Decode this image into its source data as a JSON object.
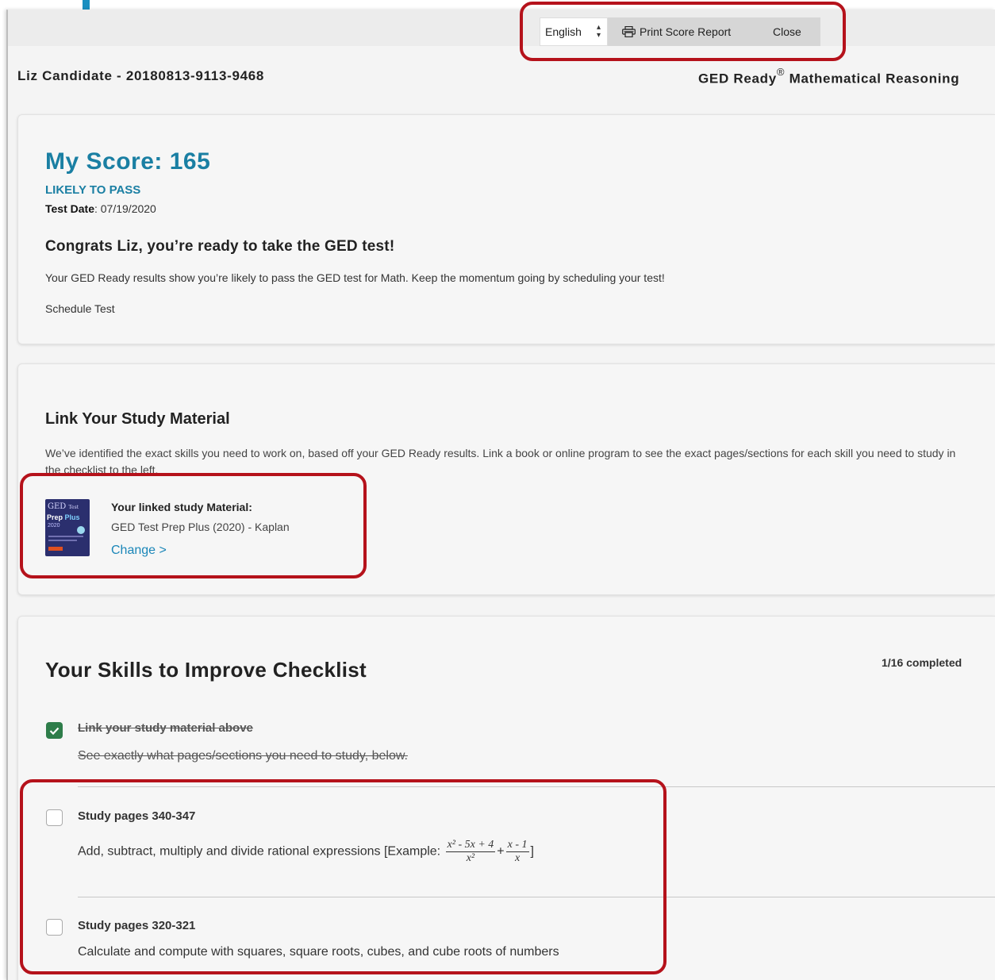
{
  "toolbar": {
    "language": "English",
    "print_label": "Print Score Report",
    "close_label": "Close"
  },
  "header": {
    "candidate": "Liz Candidate - 20180813-9113-9468",
    "test_name_pre": "GED Ready",
    "test_name_mark": "®",
    "test_name_post": " Mathematical Reasoning"
  },
  "score": {
    "title": "My Score: 165",
    "status": "LIKELY TO PASS",
    "test_date_label": "Test Date",
    "test_date_value": ": 07/19/2020",
    "congrats": "Congrats Liz, you’re ready to take the GED test!",
    "message": "Your GED Ready results show you’re likely to pass the GED test for Math. Keep the momentum going by scheduling your test!",
    "schedule_label": "Schedule Test"
  },
  "study_material": {
    "heading": "Link Your Study Material",
    "description": "We’ve identified the exact skills you need to work on, based off your GED Ready results. Link a book or online program to see the exact pages/sections for each skill you need to study in the checklist to the left.",
    "linked_label": "Your linked study Material:",
    "linked_name": "GED Test Prep Plus (2020) - Kaplan",
    "change_label": "Change >",
    "book_cover": {
      "line1": "GED",
      "line1_small": "Test",
      "line2a": "Prep",
      "line2b": " Plus",
      "line3": "2020"
    }
  },
  "checklist": {
    "heading": "Your Skills to Improve Checklist",
    "progress": "1/16 completed",
    "items": [
      {
        "title": "Link your study material above",
        "description": "See exactly what pages/sections you need to study, below.",
        "checked": true
      },
      {
        "title": "Study pages 340-347",
        "description": "Add, subtract, multiply and divide rational expressions [Example: ",
        "description_end": "]",
        "fraction1_num": "x² - 5x + 4",
        "fraction1_den": "x²",
        "operator": "+",
        "fraction2_num": "x - 1",
        "fraction2_den": "x",
        "checked": false
      },
      {
        "title": "Study pages 320-321",
        "description": "Calculate and compute with squares, square roots, cubes, and cube roots of numbers",
        "checked": false
      }
    ]
  },
  "colors": {
    "accent": "#1a7fa3",
    "highlight_box": "#b5121b",
    "check_green": "#2e7d4a",
    "link": "#1a86b8"
  }
}
